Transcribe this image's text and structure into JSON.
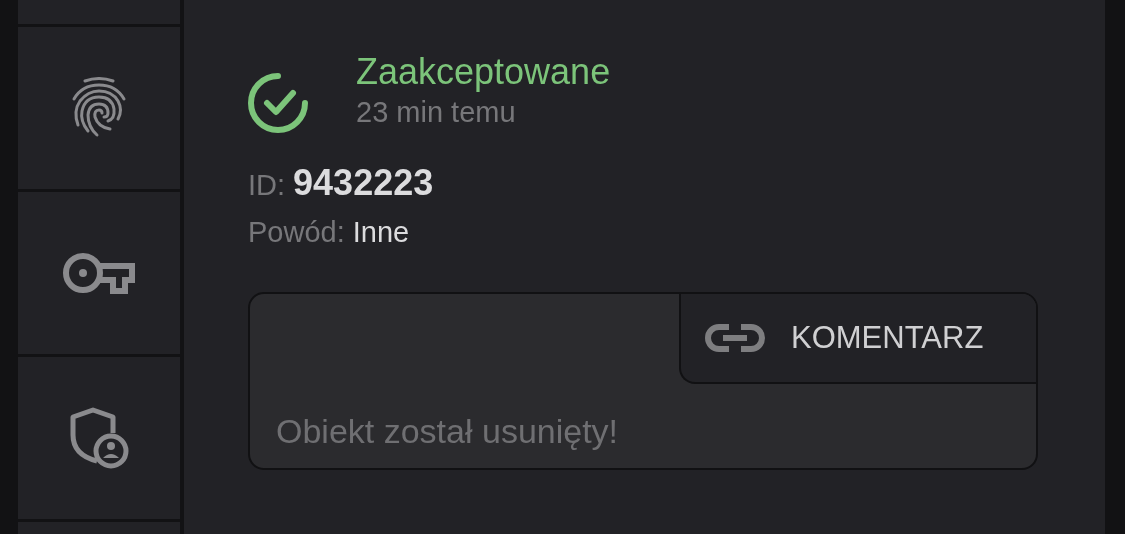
{
  "status": {
    "kind": "accepted",
    "title": "Zaakceptowane",
    "time": "23 min temu"
  },
  "details": [
    {
      "label": "ID:",
      "value": "9432223",
      "kind": "id"
    },
    {
      "label": "Powód:",
      "value": "Inne",
      "kind": "plain"
    }
  ],
  "comment": {
    "button": "KOMENTARZ",
    "text": "Obiekt został usunięty!"
  }
}
